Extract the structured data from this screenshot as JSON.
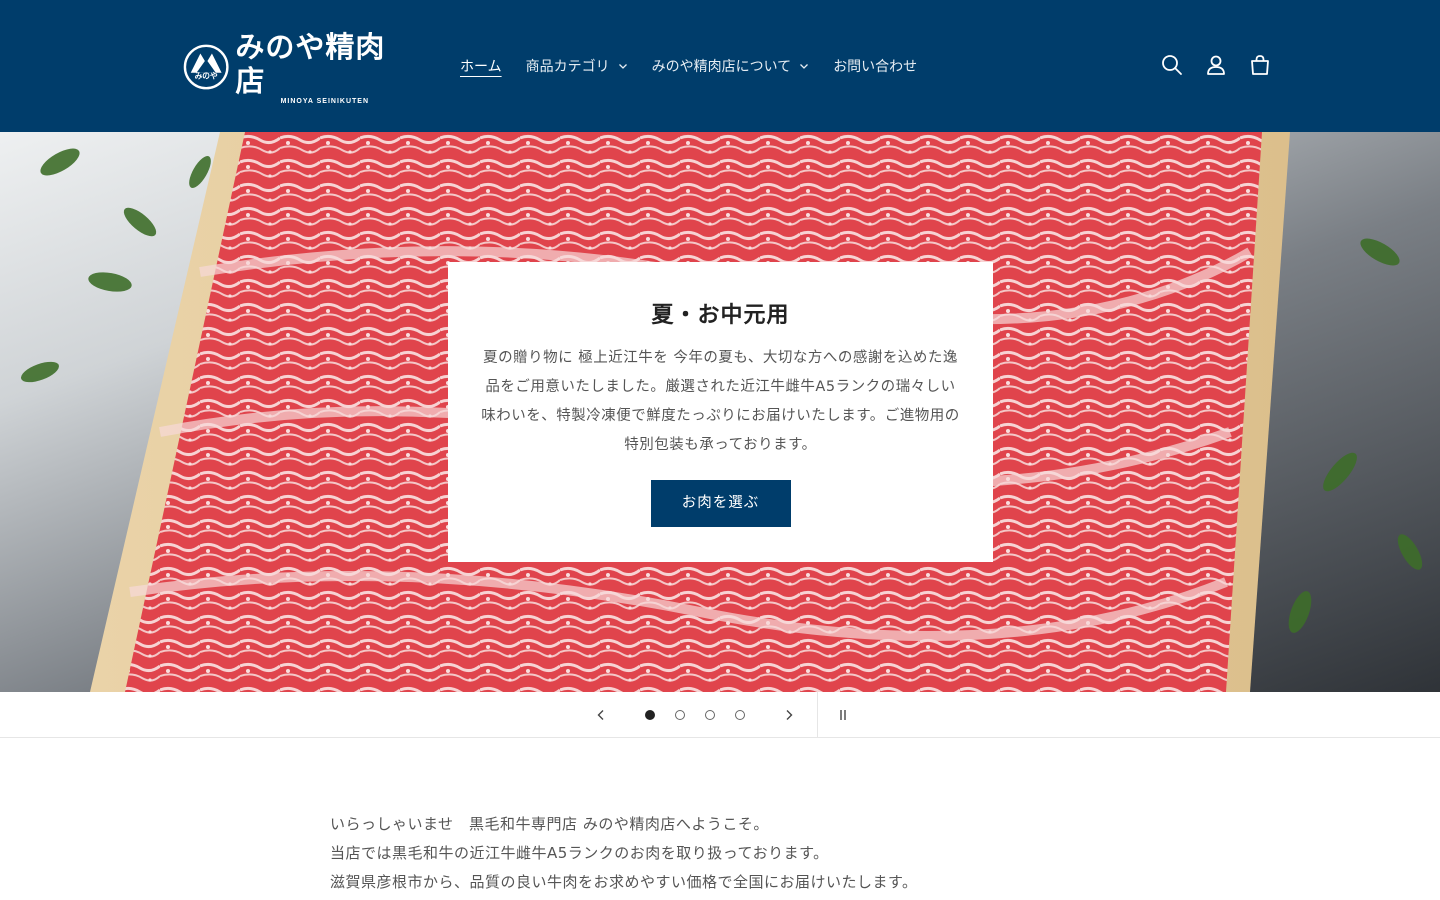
{
  "header": {
    "logo_name": "みのや精肉店",
    "logo_sub": "MINOYA SEINIKUTEN",
    "logo_mark_text": "みのや",
    "nav": [
      {
        "label": "ホーム",
        "dropdown": false,
        "active": true
      },
      {
        "label": "商品カテゴリ",
        "dropdown": true,
        "active": false
      },
      {
        "label": "みのや精肉店について",
        "dropdown": true,
        "active": false
      },
      {
        "label": "お問い合わせ",
        "dropdown": false,
        "active": false
      }
    ],
    "icons": [
      "search-icon",
      "account-icon",
      "cart-icon"
    ],
    "background": "#003d6b"
  },
  "hero": {
    "title": "夏・お中元用",
    "text": "夏の贈り物に 極上近江牛を 今年の夏も、大切な方への感謝を込めた逸品をご用意いたしました。厳選された近江牛雌牛A5ランクの瑞々しい味わいを、特製冷凍便で鮮度たっぷりにお届けいたします。ご進物用の特別包装も承っております。",
    "button": "お肉を選ぶ",
    "button_color": "#003d6b"
  },
  "slider": {
    "slide_count": 4,
    "active_slide": 1,
    "controls": [
      "previous-icon",
      "next-icon",
      "pause-icon"
    ]
  },
  "intro": {
    "lines": [
      "いらっしゃいませ　黒毛和牛専門店 みのや精肉店へようこそ。",
      "当店では黒毛和牛の近江牛雌牛A5ランクのお肉を取り扱っております。",
      "滋賀県彦根市から、品質の良い牛肉をお求めやすい価格で全国にお届けいたします。"
    ]
  }
}
